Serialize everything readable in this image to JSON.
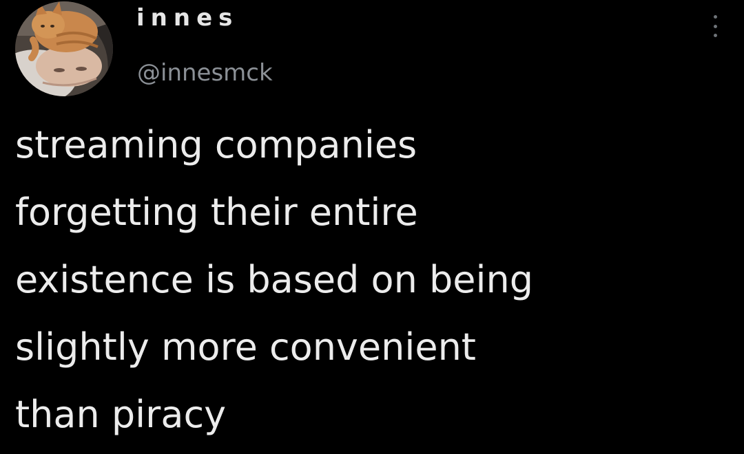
{
  "post": {
    "author": {
      "display_name": "innes",
      "handle": "@innesmck",
      "avatar_icon": "avatar-person-with-cat-icon"
    },
    "menu_icon": "more-options-icon",
    "text_lines": [
      "streaming companies",
      "forgetting their entire",
      "existence is based on being",
      "slightly more convenient",
      "than piracy"
    ]
  },
  "colors": {
    "background": "#000000",
    "text": "#ececec",
    "handle": "#8b9096"
  }
}
